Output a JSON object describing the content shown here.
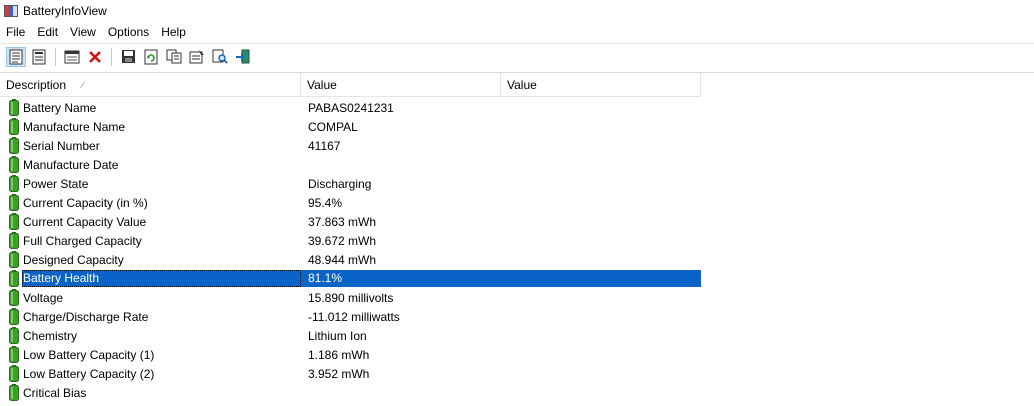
{
  "window": {
    "title": "BatteryInfoView"
  },
  "menu": [
    "File",
    "Edit",
    "View",
    "Options",
    "Help"
  ],
  "toolbar": {
    "buttons": [
      {
        "icon": "html-report-icon"
      },
      {
        "icon": "text-report-icon"
      },
      {
        "icon": "properties-window-icon"
      },
      {
        "icon": "delete-icon"
      },
      {
        "icon": "save-icon"
      },
      {
        "icon": "refresh-icon"
      },
      {
        "icon": "copy-icon"
      },
      {
        "icon": "properties-icon"
      },
      {
        "icon": "find-icon"
      },
      {
        "icon": "exit-icon"
      }
    ]
  },
  "columns": {
    "description": "Description",
    "value1": "Value",
    "value2": "Value",
    "sort_indicator": "⁄"
  },
  "rows": [
    {
      "description": "Battery Name",
      "value": "PABAS0241231",
      "value2": ""
    },
    {
      "description": "Manufacture Name",
      "value": "COMPAL",
      "value2": ""
    },
    {
      "description": "Serial Number",
      "value": "41167",
      "value2": ""
    },
    {
      "description": "Manufacture Date",
      "value": "",
      "value2": ""
    },
    {
      "description": "Power State",
      "value": "Discharging",
      "value2": ""
    },
    {
      "description": "Current Capacity (in %)",
      "value": "95.4%",
      "value2": ""
    },
    {
      "description": "Current Capacity Value",
      "value": "37.863 mWh",
      "value2": ""
    },
    {
      "description": "Full Charged Capacity",
      "value": "39.672 mWh",
      "value2": ""
    },
    {
      "description": "Designed Capacity",
      "value": "48.944 mWh",
      "value2": ""
    },
    {
      "description": "Battery Health",
      "value": "81.1%",
      "value2": "",
      "selected": true
    },
    {
      "description": "Voltage",
      "value": "15.890 millivolts",
      "value2": ""
    },
    {
      "description": "Charge/Discharge Rate",
      "value": "-11.012 milliwatts",
      "value2": ""
    },
    {
      "description": "Chemistry",
      "value": "Lithium Ion",
      "value2": ""
    },
    {
      "description": "Low Battery Capacity (1)",
      "value": "1.186 mWh",
      "value2": ""
    },
    {
      "description": "Low Battery Capacity (2)",
      "value": "3.952 mWh",
      "value2": ""
    },
    {
      "description": "Critical Bias",
      "value": "",
      "value2": ""
    }
  ],
  "colors": {
    "selection": "#0a64c8",
    "battery_green": "#3aa02a"
  }
}
